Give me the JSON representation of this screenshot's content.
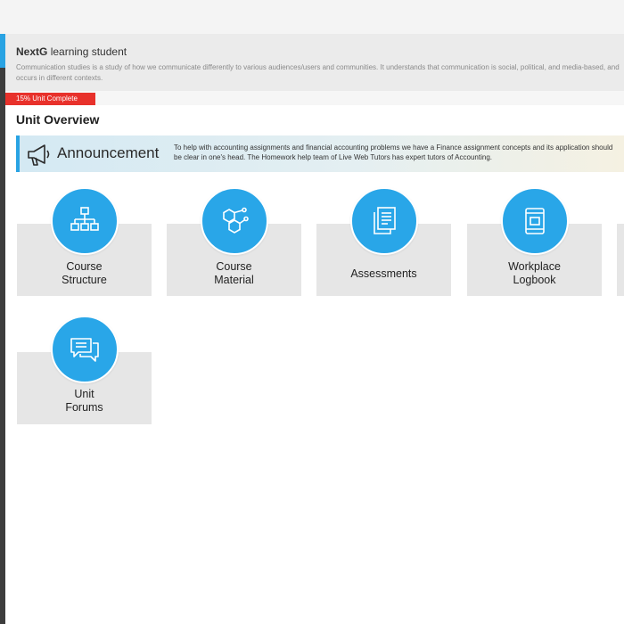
{
  "header": {
    "brand": "NextG",
    "subtitle": "learning student",
    "description": "Communication studies is a study of how we communicate differently to various audiences/users and communities. It understands that communication is social, political, and media-based, and occurs in different contexts."
  },
  "progress": {
    "label": "15% Unit Complete",
    "percent": 15,
    "color": "#e8312b"
  },
  "section_title": "Unit Overview",
  "announcement": {
    "title": "Announcement",
    "text": "To help with accounting assignments and financial accounting problems we have a Finance assignment concepts and its application should be clear in one's head. The Homework help team of Live Web Tutors has expert tutors of Accounting."
  },
  "cards": [
    {
      "label": "Course\nStructure",
      "icon": "hierarchy-icon"
    },
    {
      "label": "Course\nMaterial",
      "icon": "molecule-icon"
    },
    {
      "label": "Assessments",
      "icon": "documents-icon"
    },
    {
      "label": "Workplace\nLogbook",
      "icon": "logbook-icon"
    },
    {
      "label": "Unit\nForums",
      "icon": "chat-bubbles-icon"
    }
  ],
  "colors": {
    "accent": "#29a6e8",
    "card_bg": "#e6e6e6"
  }
}
